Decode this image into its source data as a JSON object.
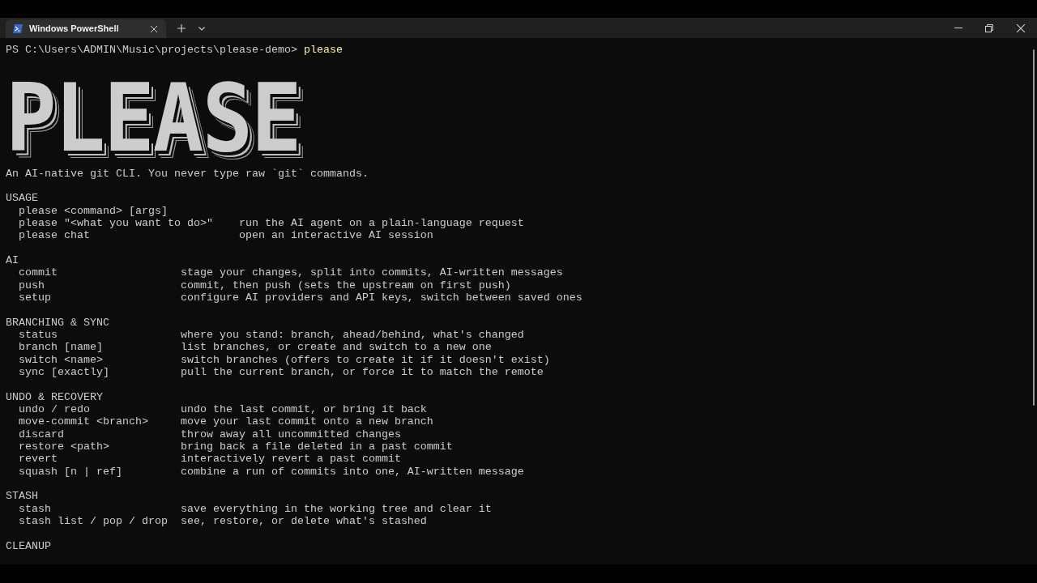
{
  "window": {
    "tabs": [
      {
        "title": "Windows PowerShell",
        "selected": true
      }
    ]
  },
  "prompt": {
    "path": "PS C:\\Users\\ADMIN\\Music\\projects\\please-demo>",
    "command": "please"
  },
  "banner": "PLEASE",
  "tagline": "An AI-native git CLI. You never type raw `git` commands.",
  "sections": [
    {
      "kind": "usage",
      "heading": "USAGE",
      "rows": [
        {
          "command": "please <command> [args]"
        },
        {
          "command": "please \"<what you want to do>\"",
          "description": "run the AI agent on a plain-language request"
        },
        {
          "command": "please chat",
          "description": "open an interactive AI session"
        }
      ]
    },
    {
      "kind": "commands",
      "heading": "AI",
      "rows": [
        {
          "command": "commit",
          "description": "stage your changes, split into commits, AI-written messages"
        },
        {
          "command": "push",
          "description": "commit, then push (sets the upstream on first push)"
        },
        {
          "command": "setup",
          "description": "configure AI providers and API keys, switch between saved ones"
        }
      ]
    },
    {
      "kind": "commands",
      "heading": "BRANCHING & SYNC",
      "rows": [
        {
          "command": "status",
          "description": "where you stand: branch, ahead/behind, what's changed"
        },
        {
          "command": "branch [name]",
          "description": "list branches, or create and switch to a new one"
        },
        {
          "command": "switch <name>",
          "description": "switch branches (offers to create it if it doesn't exist)"
        },
        {
          "command": "sync [exactly]",
          "description": "pull the current branch, or force it to match the remote"
        }
      ]
    },
    {
      "kind": "commands",
      "heading": "UNDO & RECOVERY",
      "rows": [
        {
          "command": "undo / redo",
          "description": "undo the last commit, or bring it back"
        },
        {
          "command": "move-commit <branch>",
          "description": "move your last commit onto a new branch"
        },
        {
          "command": "discard",
          "description": "throw away all uncommitted changes"
        },
        {
          "command": "restore <path>",
          "description": "bring back a file deleted in a past commit"
        },
        {
          "command": "revert",
          "description": "interactively revert a past commit"
        },
        {
          "command": "squash [n | ref]",
          "description": "combine a run of commits into one, AI-written message"
        }
      ]
    },
    {
      "kind": "commands",
      "heading": "STASH",
      "rows": [
        {
          "command": "stash",
          "description": "save everything in the working tree and clear it"
        },
        {
          "command": "stash list / pop / drop",
          "description": "see, restore, or delete what's stashed"
        }
      ]
    },
    {
      "kind": "commands",
      "heading": "CLEANUP"
    }
  ]
}
